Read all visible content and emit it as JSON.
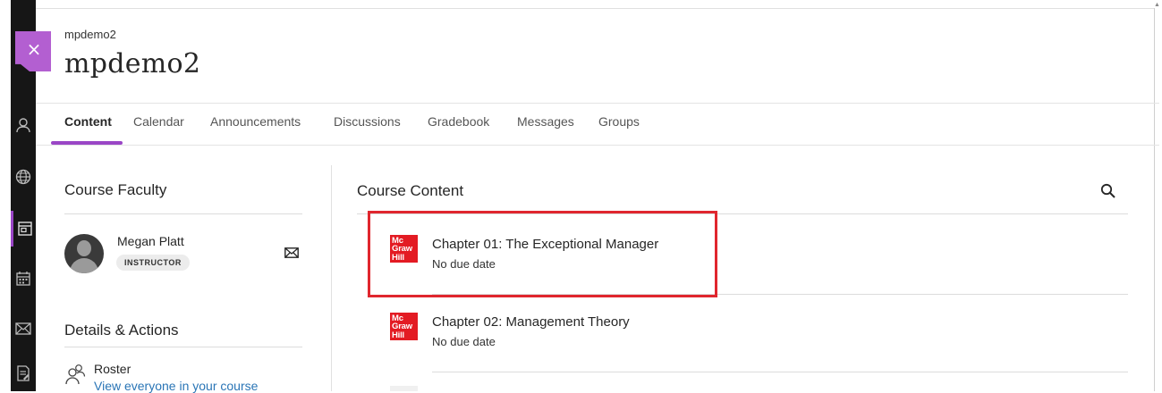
{
  "sidebar": {
    "close_label": "×",
    "icons": [
      "profile-icon",
      "globe-icon",
      "courses-icon",
      "calendar-icon",
      "mail-icon",
      "grades-icon"
    ]
  },
  "course": {
    "breadcrumb": "mpdemo2",
    "title": "mpdemo2"
  },
  "tabs": [
    "Content",
    "Calendar",
    "Announcements",
    "Discussions",
    "Gradebook",
    "Messages",
    "Groups"
  ],
  "faculty": {
    "heading": "Course Faculty",
    "name": "Megan Platt",
    "role": "INSTRUCTOR"
  },
  "details": {
    "heading": "Details & Actions",
    "roster_label": "Roster",
    "roster_link": "View everyone in your course"
  },
  "content": {
    "heading": "Course Content",
    "items": [
      {
        "logo": [
          "Mc",
          "Graw",
          "Hill"
        ],
        "title": "Chapter 01: The Exceptional Manager",
        "due": "No due date"
      },
      {
        "logo": [
          "Mc",
          "Graw",
          "Hill"
        ],
        "title": "Chapter 02: Management Theory",
        "due": "No due date"
      }
    ]
  },
  "colors": {
    "accent": "#9a46c6",
    "highlight": "#e0262e",
    "logo_red": "#e31b23",
    "link": "#2a75b6"
  }
}
